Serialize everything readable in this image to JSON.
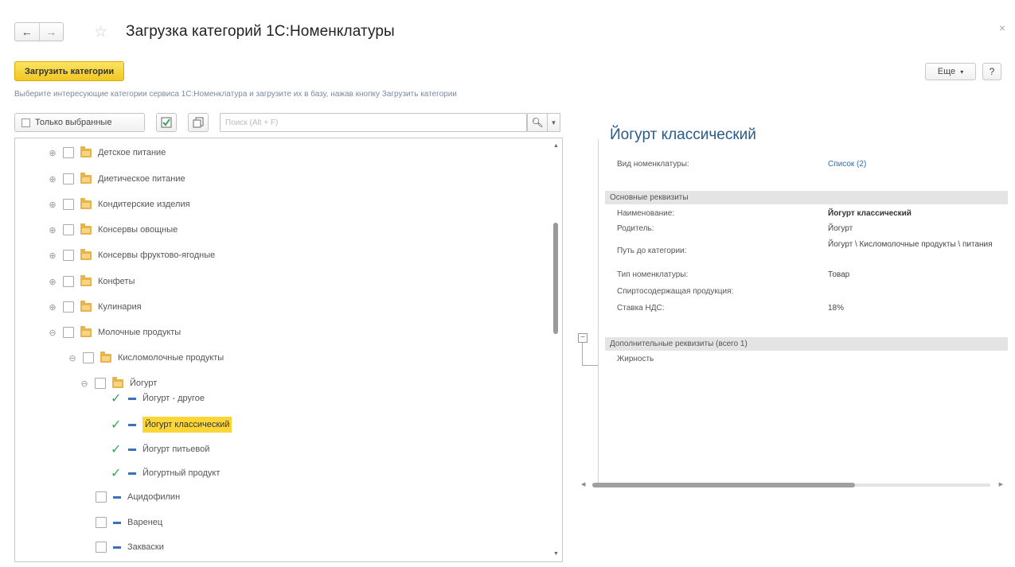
{
  "window": {
    "title": "Загрузка категорий 1С:Номенклатуры",
    "back_icon": "arrow-left-icon",
    "forward_icon": "arrow-right-icon",
    "favorite_icon": "star-icon",
    "close_label": "×"
  },
  "toolbar": {
    "load_label": "Загрузить категории",
    "more_label": "Еще",
    "help_label": "?"
  },
  "hint_text": "Выберите интересующие категории сервиса 1С:Номенклатура и загрузите их в базу, нажав кнопку Загрузить категории",
  "tree_toolbar": {
    "only_selected_label": "Только выбранные",
    "search_placeholder": "Поиск (Alt + F)"
  },
  "tree": {
    "items": [
      {
        "label": "Детское питание",
        "kind": "folder",
        "expand": "⊕"
      },
      {
        "label": "Диетическое питание",
        "kind": "folder",
        "expand": "⊕"
      },
      {
        "label": "Кондитерские изделия",
        "kind": "folder",
        "expand": "⊕"
      },
      {
        "label": "Консервы овощные",
        "kind": "folder",
        "expand": "⊕"
      },
      {
        "label": "Консервы фруктово-ягодные",
        "kind": "folder",
        "expand": "⊕"
      },
      {
        "label": "Конфеты",
        "kind": "folder",
        "expand": "⊕"
      },
      {
        "label": "Кулинария",
        "kind": "folder",
        "expand": "⊕"
      },
      {
        "label": "Молочные продукты",
        "kind": "folder",
        "expand": "⊖"
      },
      {
        "label": "Кисломолочные продукты",
        "kind": "folder",
        "expand": "⊖"
      },
      {
        "label": "Йогурт",
        "kind": "folder",
        "expand": "⊖"
      },
      {
        "label": "Йогурт - другое",
        "kind": "item",
        "checked": true
      },
      {
        "label": "Йогурт классический",
        "kind": "item",
        "checked": true,
        "selected": true
      },
      {
        "label": "Йогурт питьевой",
        "kind": "item",
        "checked": true
      },
      {
        "label": "Йогуртный продукт",
        "kind": "item",
        "checked": true
      },
      {
        "label": "Ацидофилин",
        "kind": "item",
        "checked": false
      },
      {
        "label": "Варенец",
        "kind": "item",
        "checked": false
      },
      {
        "label": "Закваски",
        "kind": "item",
        "checked": false
      }
    ]
  },
  "detail": {
    "title": "Йогурт классический",
    "kind_label": "Вид номенклатуры:",
    "kind_value": "Список (2)",
    "main_section": "Основные реквизиты",
    "rows": [
      {
        "label": "Наименование:",
        "value": "Йогурт классический"
      },
      {
        "label": "Родитель:",
        "value": "Йогурт"
      },
      {
        "label": "Путь до категории:",
        "value": "Йогурт \\ Кисломолочные продукты \\ питания"
      },
      {
        "label": "Тип номенклатуры:",
        "value": "Товар"
      },
      {
        "label": "Спиртосодержащая продукция:",
        "value": ""
      },
      {
        "label": "Ставка НДС:",
        "value": "18%"
      }
    ],
    "extra_section": "Дополнительные реквизиты (всего 1)",
    "extra_rows": [
      {
        "label": "Жирность"
      }
    ]
  },
  "colors": {
    "accent_yellow": "#f5d23a",
    "link_blue": "#2a6ab8",
    "check_green": "#3aa35a"
  }
}
